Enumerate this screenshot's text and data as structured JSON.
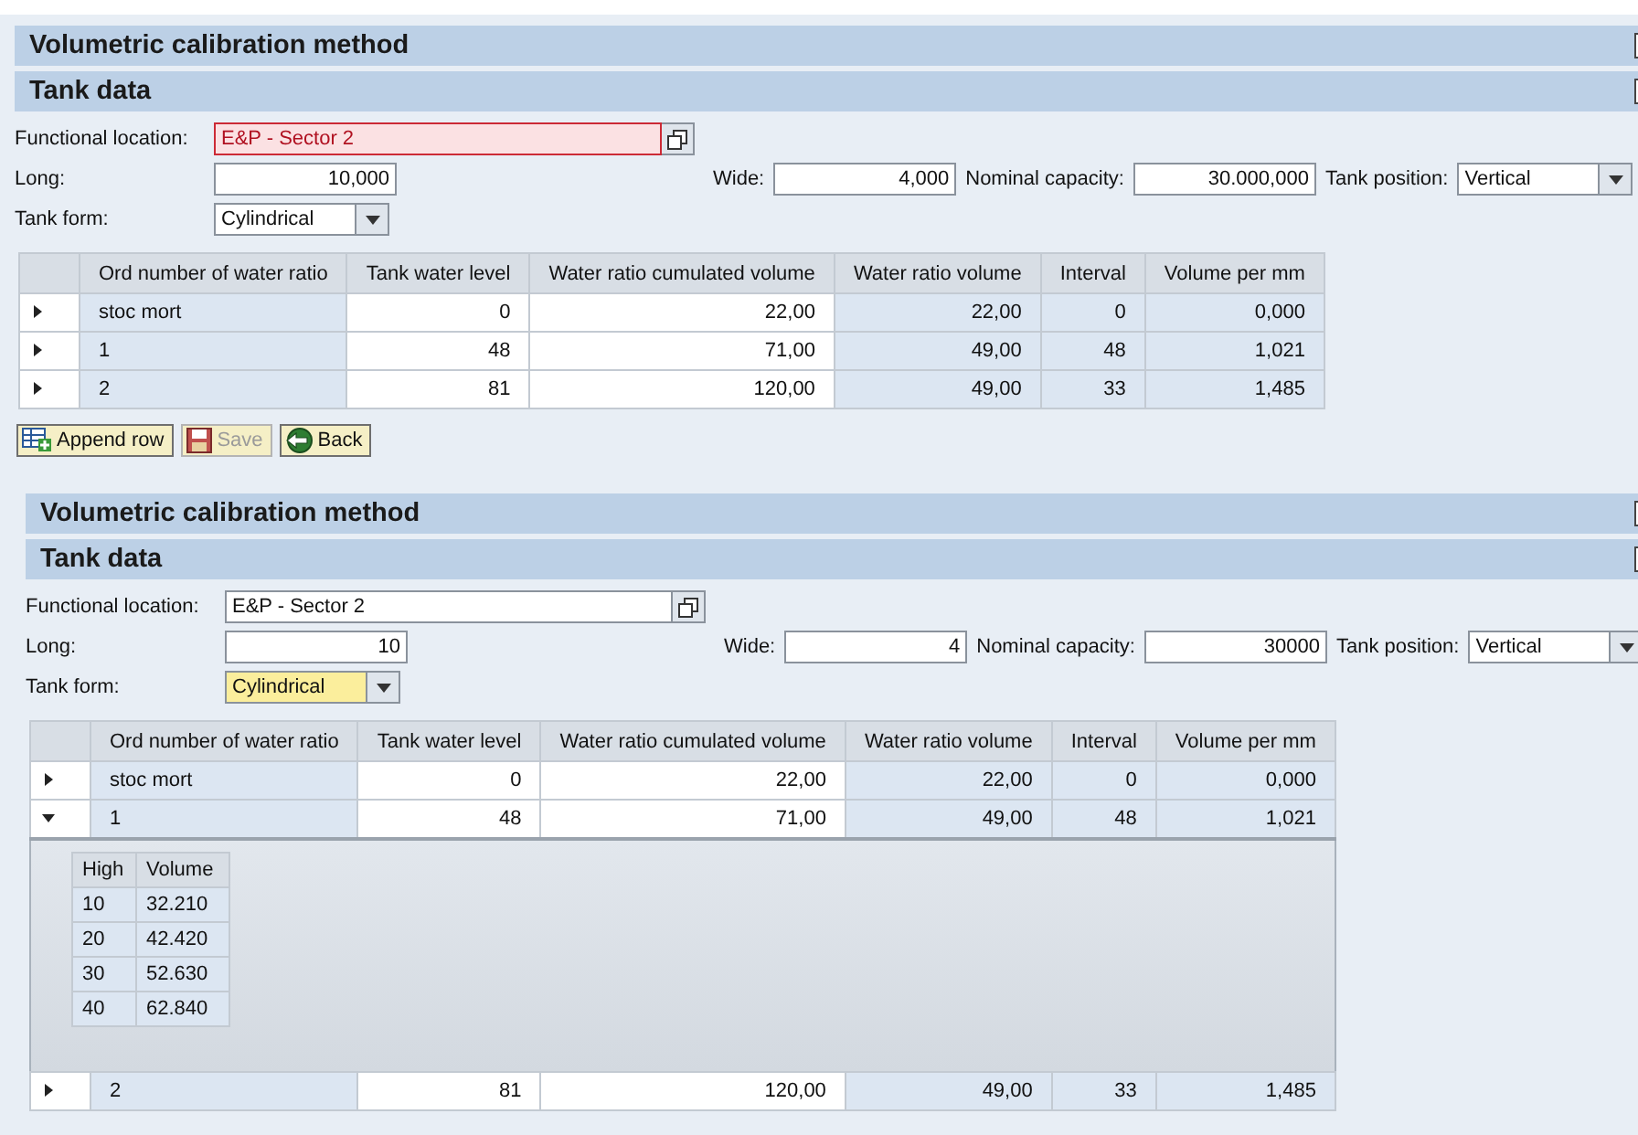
{
  "panels": [
    {
      "title": "Volumetric calibration method",
      "section": "Tank data",
      "field_rows": [
        [
          {
            "kind": "lookup",
            "label": "Functional location:",
            "value": "E&P - Sector 2",
            "invalid": true,
            "highlighted": false
          }
        ],
        [
          {
            "kind": "number",
            "label": "Long:",
            "value": "10,000",
            "invalid": false,
            "highlighted": false
          },
          {
            "kind": "number",
            "label": "Wide:",
            "value": "4,000",
            "invalid": false,
            "highlighted": false
          },
          {
            "kind": "number",
            "label": "Nominal capacity:",
            "value": "30.000,000",
            "invalid": false,
            "highlighted": false
          },
          {
            "kind": "dropdown",
            "label": "Tank position:",
            "value": "Vertical",
            "invalid": false,
            "highlighted": false
          }
        ],
        [
          {
            "kind": "dropdown",
            "label": "Tank form:",
            "value": "Cylindrical",
            "invalid": false,
            "highlighted": false
          }
        ]
      ],
      "table": {
        "columns": [
          {
            "label": "Ord number of water ratio",
            "editable": false
          },
          {
            "label": "Tank water level",
            "editable": true
          },
          {
            "label": "Water ratio cumulated volume",
            "editable": true
          },
          {
            "label": "Water ratio volume",
            "editable": false
          },
          {
            "label": "Interval",
            "editable": false
          },
          {
            "label": "Volume per mm",
            "editable": false
          }
        ],
        "rows": [
          {
            "cells": [
              "stoc mort",
              "0",
              "22,00",
              "22,00",
              "0",
              "0,000"
            ],
            "expanded": false
          },
          {
            "cells": [
              "1",
              "48",
              "71,00",
              "49,00",
              "48",
              "1,021"
            ],
            "expanded": false
          },
          {
            "cells": [
              "2",
              "81",
              "120,00",
              "49,00",
              "33",
              "1,485"
            ],
            "expanded": false
          }
        ]
      },
      "buttons": [
        {
          "kind": "append",
          "label": "Append row",
          "disabled": false
        },
        {
          "kind": "save",
          "label": "Save",
          "disabled": true
        },
        {
          "kind": "back",
          "label": "Back",
          "disabled": false
        }
      ]
    },
    {
      "title": "Volumetric calibration method",
      "section": "Tank data",
      "field_rows": [
        [
          {
            "kind": "lookup",
            "label": "Functional location:",
            "value": "E&P - Sector 2",
            "invalid": false,
            "highlighted": false
          }
        ],
        [
          {
            "kind": "number",
            "label": "Long:",
            "value": "10",
            "invalid": false,
            "highlighted": false
          },
          {
            "kind": "number",
            "label": "Wide:",
            "value": "4",
            "invalid": false,
            "highlighted": false
          },
          {
            "kind": "number",
            "label": "Nominal capacity:",
            "value": "30000",
            "invalid": false,
            "highlighted": false
          },
          {
            "kind": "dropdown",
            "label": "Tank position:",
            "value": "Vertical",
            "invalid": false,
            "highlighted": false
          }
        ],
        [
          {
            "kind": "dropdown",
            "label": "Tank form:",
            "value": "Cylindrical",
            "invalid": false,
            "highlighted": true
          }
        ]
      ],
      "table": {
        "columns": [
          {
            "label": "Ord number of water ratio",
            "editable": false
          },
          {
            "label": "Tank water level",
            "editable": true
          },
          {
            "label": "Water ratio cumulated volume",
            "editable": true
          },
          {
            "label": "Water ratio volume",
            "editable": false
          },
          {
            "label": "Interval",
            "editable": false
          },
          {
            "label": "Volume per mm",
            "editable": false
          }
        ],
        "rows": [
          {
            "cells": [
              "stoc mort",
              "0",
              "22,00",
              "22,00",
              "0",
              "0,000"
            ],
            "expanded": false
          },
          {
            "cells": [
              "1",
              "48",
              "71,00",
              "49,00",
              "48",
              "1,021"
            ],
            "expanded": true,
            "detail": {
              "columns": [
                "High",
                "Volume"
              ],
              "rows": [
                [
                  "10",
                  "32.210"
                ],
                [
                  "20",
                  "42.420"
                ],
                [
                  "30",
                  "52.630"
                ],
                [
                  "40",
                  "62.840"
                ]
              ]
            }
          },
          {
            "cells": [
              "2",
              "81",
              "120,00",
              "49,00",
              "33",
              "1,485"
            ],
            "expanded": false
          }
        ]
      }
    }
  ]
}
